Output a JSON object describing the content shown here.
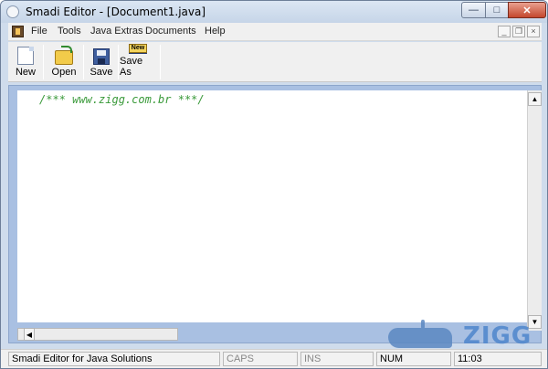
{
  "window": {
    "title": "Smadi Editor - [Document1.java]",
    "close_label": "✕",
    "min_label": "—",
    "max_label": "□"
  },
  "menu": {
    "items": [
      "File",
      "Tools",
      "Java Extras",
      "Documents",
      "Help"
    ],
    "mdi_min": "_",
    "mdi_restore": "❐",
    "mdi_close": "×"
  },
  "toolbar": {
    "buttons": [
      {
        "label": "New",
        "icon": "new-document-icon"
      },
      {
        "label": "Open",
        "icon": "open-folder-icon"
      },
      {
        "label": "Save",
        "icon": "floppy-disk-icon"
      },
      {
        "label": "Save As",
        "icon": "save-as-icon",
        "badge": "New"
      }
    ]
  },
  "editor": {
    "code": "/*** www.zigg.com.br ***/"
  },
  "scrollbar": {
    "up": "▲",
    "down": "▼",
    "left": "◀"
  },
  "watermark": {
    "text": "ZIGG"
  },
  "status": {
    "message": "Smadi Editor for Java Solutions",
    "caps": "CAPS",
    "ins": "INS",
    "num": "NUM",
    "time": "11:03"
  },
  "colors": {
    "code_comment": "#3a9a3a",
    "editor_frame": "#a9c0e2",
    "title_bar": "#cfdcec"
  }
}
